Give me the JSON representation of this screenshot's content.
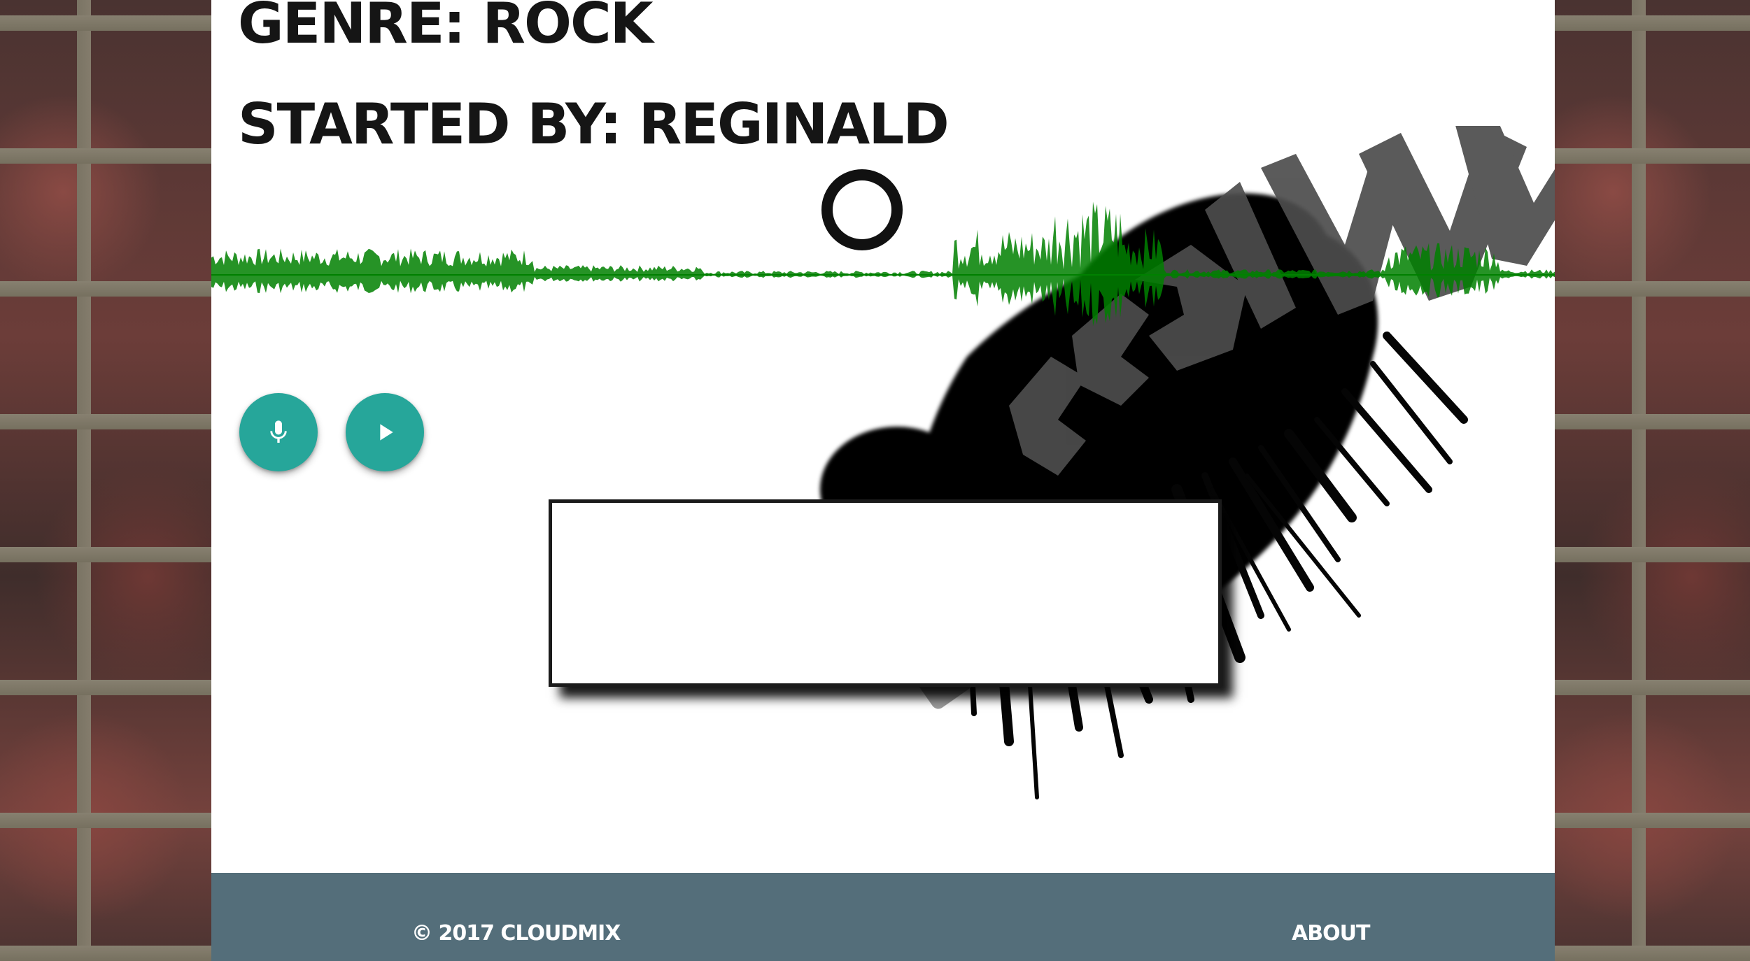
{
  "track": {
    "genre_heading": "Genre: Rock",
    "starter_heading": "Started By: Reginald"
  },
  "waveform": {
    "color": "#008000"
  },
  "controls": {
    "mic_icon": "mic-icon",
    "play_icon": "play-icon",
    "button_color": "#26a69a"
  },
  "footer": {
    "copyright": "© 2017 CLOUDMIX",
    "about_label": "About",
    "background": "#546e7a"
  }
}
